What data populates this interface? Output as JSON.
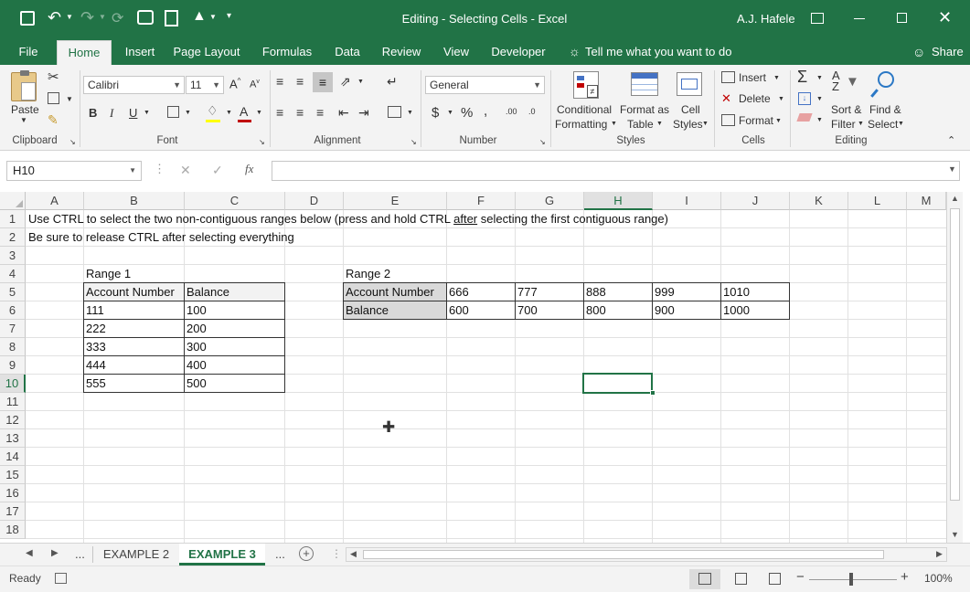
{
  "titlebar": {
    "title": "Editing - Selecting Cells  -  Excel",
    "user": "A.J. Hafele"
  },
  "ribbon_tabs": [
    "File",
    "Home",
    "Insert",
    "Page Layout",
    "Formulas",
    "Data",
    "Review",
    "View",
    "Developer"
  ],
  "tell_me": "Tell me what you want to do",
  "share": "Share",
  "ribbon": {
    "clipboard": {
      "paste": "Paste",
      "group": "Clipboard"
    },
    "font": {
      "name": "Calibri",
      "size": "11",
      "group": "Font"
    },
    "alignment": {
      "group": "Alignment"
    },
    "number": {
      "format": "General",
      "group": "Number"
    },
    "styles": {
      "conditional_line1": "Conditional",
      "conditional_line2": "Formatting",
      "format_table_line1": "Format as",
      "format_table_line2": "Table",
      "cell_styles_line1": "Cell",
      "cell_styles_line2": "Styles",
      "group": "Styles"
    },
    "cells": {
      "insert": "Insert",
      "delete": "Delete",
      "format": "Format",
      "group": "Cells"
    },
    "editing": {
      "sort_line1": "Sort &",
      "sort_line2": "Filter",
      "find_line1": "Find &",
      "find_line2": "Select",
      "group": "Editing"
    }
  },
  "formula_bar": {
    "name_box": "H10",
    "formula": ""
  },
  "columns": [
    "A",
    "B",
    "C",
    "D",
    "E",
    "F",
    "G",
    "H",
    "I",
    "J",
    "K",
    "L",
    "M"
  ],
  "rows": [
    "1",
    "2",
    "3",
    "4",
    "5",
    "6",
    "7",
    "8",
    "9",
    "10",
    "11",
    "12",
    "13",
    "14",
    "15",
    "16",
    "17",
    "18"
  ],
  "cells": {
    "A1": "Use CTRL to select the two non-contiguous ranges below (press and hold CTRL ",
    "A1_underlined": "after",
    "A1_tail": " selecting the first contiguous range)",
    "A2": "Be sure to release CTRL after selecting everything",
    "B4": "Range 1",
    "B5": "Account Number",
    "C5": "Balance",
    "B6": "111",
    "C6": "100",
    "B7": "222",
    "C7": "200",
    "B8": "333",
    "C8": "300",
    "B9": "444",
    "C9": "400",
    "B10": "555",
    "C10": "500",
    "E4": "Range 2",
    "E5": "Account Number",
    "F5": "666",
    "G5": "777",
    "H5": "888",
    "I5": "999",
    "J5": "1010",
    "E6": "Balance",
    "F6": "600",
    "G6": "700",
    "H6": "800",
    "I6": "900",
    "J6": "1000"
  },
  "sheets": {
    "tab1": "EXAMPLE 2",
    "tab2": "EXAMPLE 3",
    "more": "..."
  },
  "status": {
    "ready": "Ready",
    "zoom": "100%"
  },
  "colors": {
    "accent": "#217346",
    "header_fill": "#f3f3f3",
    "label_fill": "#d9d9d9"
  }
}
